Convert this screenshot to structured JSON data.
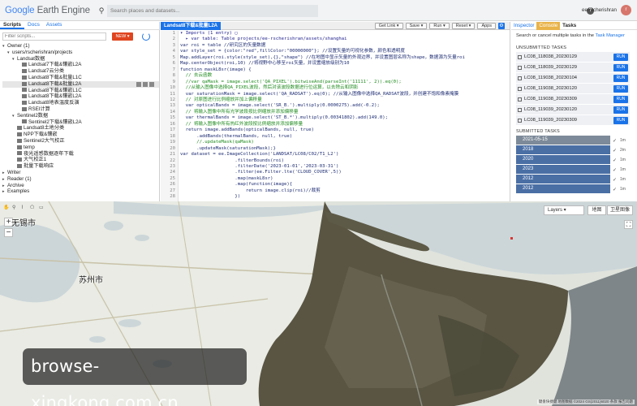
{
  "header": {
    "logo_google": "Google",
    "logo_product": "Earth Engine",
    "search_placeholder": "Search places and datasets...",
    "help_label": "?",
    "user_name": "ee-rscherishran",
    "avatar_letter": "r"
  },
  "left_panel": {
    "tabs": [
      "Scripts",
      "Docs",
      "Assets"
    ],
    "filter_placeholder": "Filter scripts...",
    "new_label": "NEW ▾",
    "tree": [
      {
        "label": "Owner (1)",
        "indent": 0,
        "arrow": "▾",
        "type": "group"
      },
      {
        "label": "users/rscherishran/projects",
        "indent": 1,
        "arrow": "▾",
        "type": "group"
      },
      {
        "label": "Landsat数据",
        "indent": 2,
        "arrow": "▾",
        "type": "folder"
      },
      {
        "label": "Landsat7下载&镶嵌L2A",
        "indent": 3,
        "arrow": "",
        "type": "file"
      },
      {
        "label": "Landsat7云分类",
        "indent": 3,
        "arrow": "",
        "type": "file"
      },
      {
        "label": "Landsat8下载&批量L1C",
        "indent": 3,
        "arrow": "",
        "type": "file"
      },
      {
        "label": "Landsat8下载&批量L2A",
        "indent": 3,
        "arrow": "",
        "type": "file",
        "selected": true
      },
      {
        "label": "Landsat8下载&镶嵌L1C",
        "indent": 3,
        "arrow": "",
        "type": "file"
      },
      {
        "label": "Landsat8下载&镶嵌L2A",
        "indent": 3,
        "arrow": "",
        "type": "file"
      },
      {
        "label": "Landsat8地表温度反演",
        "indent": 3,
        "arrow": "",
        "type": "file"
      },
      {
        "label": "RSEI计算",
        "indent": 3,
        "arrow": "",
        "type": "file"
      },
      {
        "label": "Sentinel2数据",
        "indent": 2,
        "arrow": "▾",
        "type": "folder"
      },
      {
        "label": "Sentinel2下载&镶嵌L2A",
        "indent": 3,
        "arrow": "",
        "type": "file"
      },
      {
        "label": "Landsat8土地分类",
        "indent": 2,
        "arrow": "",
        "type": "file"
      },
      {
        "label": "NPP下载&镶嵌",
        "indent": 2,
        "arrow": "",
        "type": "file"
      },
      {
        "label": "Sentinel2大气校正",
        "indent": 2,
        "arrow": "",
        "type": "file"
      },
      {
        "label": "temp",
        "indent": 2,
        "arrow": "",
        "type": "file"
      },
      {
        "label": "夜光遥感数据逐年下载",
        "indent": 2,
        "arrow": "",
        "type": "file"
      },
      {
        "label": "大气校正1",
        "indent": 2,
        "arrow": "",
        "type": "file"
      },
      {
        "label": "批量下载响应",
        "indent": 2,
        "arrow": "",
        "type": "file"
      },
      {
        "label": "Writer",
        "indent": 0,
        "arrow": "▸",
        "type": "group"
      },
      {
        "label": "Reader (1)",
        "indent": 0,
        "arrow": "▸",
        "type": "group"
      },
      {
        "label": "Archive",
        "indent": 0,
        "arrow": "▸",
        "type": "group"
      },
      {
        "label": "Examples",
        "indent": 0,
        "arrow": "▸",
        "type": "group"
      }
    ]
  },
  "editor": {
    "tab_title": "Landsat8下载&批量L2A",
    "buttons": {
      "get_link": "Get Link ▾",
      "save": "Save ▾",
      "run": "Run ▾",
      "reset": "Reset ▾",
      "apps": "Apps"
    },
    "settings_icon": "gear-icon",
    "line_numbers": [
      "",
      "",
      "1",
      "2",
      "3",
      "4",
      "5",
      "6",
      "7",
      "8",
      "9",
      "10",
      "11",
      "12",
      "13",
      "14",
      "15",
      "16",
      "17",
      "18",
      "19",
      "20",
      "21",
      "22",
      "23",
      "24",
      "25",
      "26",
      "27",
      "28"
    ],
    "lines": [
      {
        "text": "▾ Imports (1 entry) ▢",
        "cls": "kw"
      },
      {
        "text": "  ▸ var table: Table projects/ee-rscherishran/assets/shanghai",
        "cls": "kw"
      },
      {
        "text": "var roi = table //研究区的矢量数据",
        "cls": ""
      },
      {
        "text": "var style_set = {color:\"red\",fillColor:\"00000000\"}; //设置矢量的可视化参数，颜色和透明度",
        "cls": ""
      },
      {
        "text": "Map.addLayer(roi.style(style_set),{},\"shape\") //在地图中显示矢量的外观边界，并设置图层名称为shape，数据源为矢量roi",
        "cls": ""
      },
      {
        "text": "Map.centerObject(roi,10) //将视野中心移至roi矢量，并设置缩放级别为10",
        "cls": ""
      },
      {
        "text": "",
        "cls": ""
      },
      {
        "text": "function maskL8sr(image) {",
        "cls": ""
      },
      {
        "text": "  // 去云函数",
        "cls": "cm"
      },
      {
        "text": "  //var qaMask = image.select('QA_PIXEL').bitwiseAnd(parseInt('11111', 2)).eq(0);",
        "cls": "cm"
      },
      {
        "text": "  //从输入图像中选择QA_PIXEL波段，然后对该波段数据进行位运算，以去除云和阴影",
        "cls": "cm"
      },
      {
        "text": "  var saturationMask = image.select('QA_RADSAT').eq(0); //从输入图像中选择QA_RADSAT波段，并创建不饱和像素掩膜",
        "cls": ""
      },
      {
        "text": "  // 对原图进行比例缩放并加上偏移量",
        "cls": "cm"
      },
      {
        "text": "  var opticalBands = image.select('SR_B.').multiply(0.0000275).add(-0.2);",
        "cls": ""
      },
      {
        "text": "  // 将输入图像中所有光学波段按比例缩放并添加偏移量",
        "cls": "cm"
      },
      {
        "text": "  var thermalBands = image.select('ST_B.*').multiply(0.00341802).add(149.0);",
        "cls": ""
      },
      {
        "text": "  // 将输入图像中所有热红外波段按比例缩放并添加偏移量",
        "cls": "cm"
      },
      {
        "text": "  return image.addBands(opticalBands, null, true)",
        "cls": ""
      },
      {
        "text": "      .addBands(thermalBands, null, true)",
        "cls": ""
      },
      {
        "text": "      //.updateMask(qaMask)",
        "cls": "cm"
      },
      {
        "text": "      .updateMask(saturationMask);}",
        "cls": ""
      },
      {
        "text": "var dataset = ee.ImageCollection('LANDSAT/LC08/C02/T1_L2')",
        "cls": ""
      },
      {
        "text": "                    .filterBounds(roi)",
        "cls": ""
      },
      {
        "text": "                    .filterDate('2023-01-01','2023-03-31')",
        "cls": ""
      },
      {
        "text": "                    .filter(ee.Filter.lte('CLOUD_COVER',5))",
        "cls": ""
      },
      {
        "text": "                    .map(maskL8sr)",
        "cls": ""
      },
      {
        "text": "                    .map(function(image){",
        "cls": ""
      },
      {
        "text": "                        return image.clip(roi)//裁剪",
        "cls": ""
      },
      {
        "text": "                    })",
        "cls": ""
      },
      {
        "text": "",
        "cls": ""
      }
    ]
  },
  "right_panel": {
    "tabs": [
      "Inspector",
      "Console",
      "Tasks"
    ],
    "tasks_desc_1": "Search or cancel multiple tasks in the",
    "tasks_desc_link": "Task Manager",
    "unsubmitted_title": "UNSUBMITTED TASKS",
    "run_label": "RUN",
    "unsubmitted": [
      "LC08_118038_20230129",
      "LC08_118039_20230129",
      "LC08_119038_20230104",
      "LC08_119038_20230120",
      "LC08_119038_20230309",
      "LC08_119039_20230120",
      "LC08_119039_20230309"
    ],
    "submitted_title": "SUBMITTED TASKS",
    "submitted": [
      {
        "name": "2021-05-15",
        "dur": "1m",
        "dim": true
      },
      {
        "name": "2018",
        "dur": "2m",
        "dim": false
      },
      {
        "name": "2020",
        "dur": "1m",
        "dim": false
      },
      {
        "name": "2023",
        "dur": "1m",
        "dim": false
      },
      {
        "name": "2012",
        "dur": "1m",
        "dim": false
      },
      {
        "name": "2012",
        "dur": "1m",
        "dim": false
      }
    ]
  },
  "map": {
    "labels": [
      {
        "key": "wuxi",
        "text": "无锡市"
      },
      {
        "key": "suzhou",
        "text": "苏州市"
      }
    ],
    "layers_label": "Layers ▾",
    "map_type_map": "地图",
    "map_type_satellite": "卫星图像",
    "attribution": "键盘快捷键  地图数据 ©2024 GS(2011)6020  条款  报告问题",
    "watermark": "browse-xingkong.com.cn",
    "colors": {
      "water": "#ccd6d9",
      "land": "#e9ebe4",
      "imagery": "#5a5543",
      "sea": "#2e3a45"
    }
  }
}
